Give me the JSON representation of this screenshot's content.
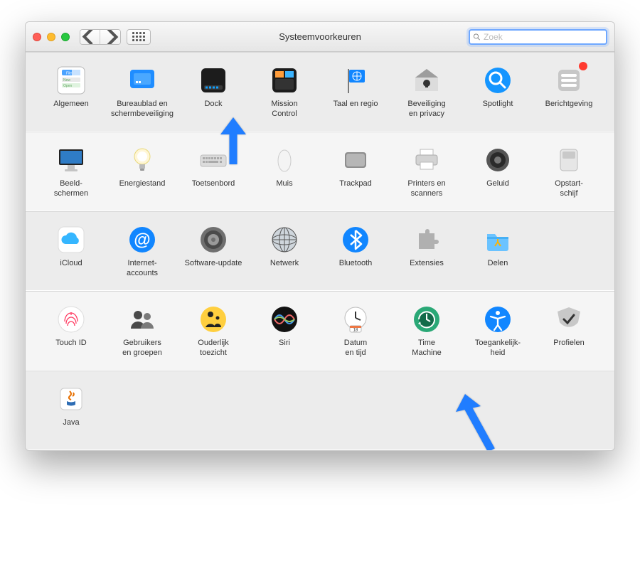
{
  "window": {
    "title": "Systeemvoorkeuren"
  },
  "search": {
    "placeholder": "Zoek"
  },
  "sections": {
    "0": [
      {
        "key": "general",
        "label": "Algemeen"
      },
      {
        "key": "desktop",
        "label": "Bureaublad en\nschermbeveiliging"
      },
      {
        "key": "dock",
        "label": "Dock"
      },
      {
        "key": "mission",
        "label": "Mission\nControl"
      },
      {
        "key": "lang",
        "label": "Taal en regio"
      },
      {
        "key": "security",
        "label": "Beveiliging\nen privacy"
      },
      {
        "key": "spotlight",
        "label": "Spotlight"
      },
      {
        "key": "notifications",
        "label": "Berichtgeving"
      }
    ],
    "1": [
      {
        "key": "displays",
        "label": "Beeld-\nschermen"
      },
      {
        "key": "energy",
        "label": "Energiestand"
      },
      {
        "key": "keyboard",
        "label": "Toetsenbord"
      },
      {
        "key": "mouse",
        "label": "Muis"
      },
      {
        "key": "trackpad",
        "label": "Trackpad"
      },
      {
        "key": "printers",
        "label": "Printers en\nscanners"
      },
      {
        "key": "sound",
        "label": "Geluid"
      },
      {
        "key": "startup",
        "label": "Opstart-\nschijf"
      }
    ],
    "2": [
      {
        "key": "icloud",
        "label": "iCloud"
      },
      {
        "key": "internet",
        "label": "Internet-\naccounts"
      },
      {
        "key": "update",
        "label": "Software-update"
      },
      {
        "key": "network",
        "label": "Netwerk"
      },
      {
        "key": "bluetooth",
        "label": "Bluetooth"
      },
      {
        "key": "extensions",
        "label": "Extensies"
      },
      {
        "key": "sharing",
        "label": "Delen"
      }
    ],
    "3": [
      {
        "key": "touchid",
        "label": "Touch ID"
      },
      {
        "key": "users",
        "label": "Gebruikers\nen groepen"
      },
      {
        "key": "parental",
        "label": "Ouderlijk\ntoezicht"
      },
      {
        "key": "siri",
        "label": "Siri"
      },
      {
        "key": "date",
        "label": "Datum\nen tijd"
      },
      {
        "key": "timemachine",
        "label": "Time\nMachine"
      },
      {
        "key": "accessibility",
        "label": "Toegankelijk-\nheid"
      },
      {
        "key": "profiles",
        "label": "Profielen"
      }
    ],
    "4": [
      {
        "key": "java",
        "label": "Java"
      }
    ]
  }
}
